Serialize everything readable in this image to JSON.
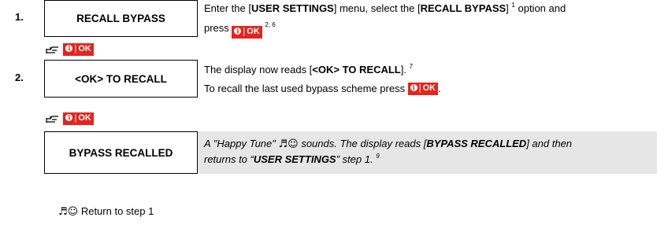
{
  "step1": {
    "number": "1.",
    "box_label": "RECALL BYPASS",
    "line1_pre": "Enter the [",
    "line1_bold1": "USER SETTINGS",
    "line1_mid": "] menu, select the [",
    "line1_bold2": "RECALL BYPASS",
    "line1_post": "]",
    "line1_sup": "1",
    "line1_end": " option and",
    "line2_pre": "press",
    "line2_sup": "2, 6"
  },
  "ok_button": {
    "info": "i",
    "sep": "|",
    "label": "OK"
  },
  "step2": {
    "number": "2.",
    "box_label": "<OK> TO RECALL",
    "line1_pre": "The display now reads [",
    "line1_bold": "<OK> TO RECALL",
    "line1_post": "].",
    "line1_sup": "7",
    "line2": "To recall the last used bypass scheme press",
    "line2_end": "."
  },
  "step3": {
    "box_label": "BYPASS RECALLED",
    "line1_pre": "A \"Happy Tune\" ",
    "line1_tune": "♬☺",
    "line1_mid": " sounds. The display reads [",
    "line1_bold": "BYPASS RECALLED",
    "line1_post": "] and then",
    "line2_pre": "returns to “",
    "line2_bold": "USER SETTINGS",
    "line2_post": "” step 1.",
    "line2_sup": "9"
  },
  "footer": {
    "tune": "♬☺",
    "text": " Return to step 1"
  },
  "icons": [
    "hand-pointing-icon",
    "info-icon"
  ]
}
